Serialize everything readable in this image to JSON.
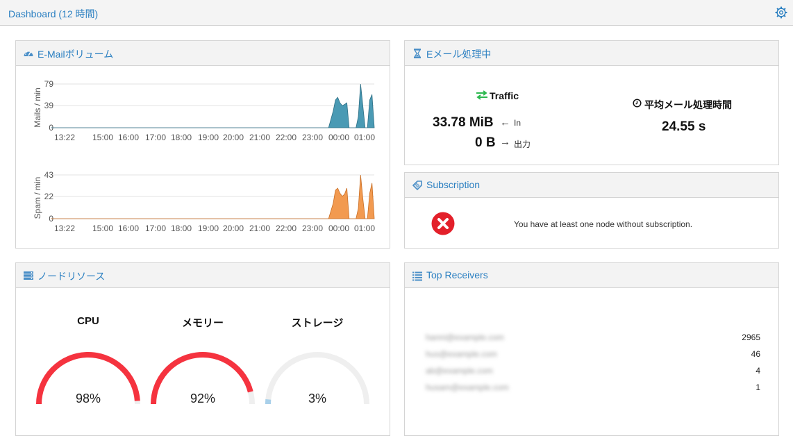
{
  "header": {
    "title": "Dashboard (12 時間)",
    "settings_icon": "gear-icon"
  },
  "volume_panel": {
    "title": "E-Mailボリューム",
    "icon": "dashboard-icon",
    "mail_chart": {
      "ylabel": "Mails / min",
      "yticks": [
        "79",
        "39",
        "0"
      ],
      "xticks": [
        "13:22",
        "15:00",
        "16:00",
        "17:00",
        "18:00",
        "19:00",
        "20:00",
        "21:00",
        "22:00",
        "23:00",
        "00:00",
        "01:00"
      ]
    },
    "spam_chart": {
      "ylabel": "Spam / min",
      "yticks": [
        "43",
        "22",
        "0"
      ],
      "xticks": [
        "13:22",
        "15:00",
        "16:00",
        "17:00",
        "18:00",
        "19:00",
        "20:00",
        "21:00",
        "22:00",
        "23:00",
        "00:00",
        "01:00"
      ]
    }
  },
  "chart_data": [
    {
      "type": "area",
      "title": "",
      "ylabel": "Mails / min",
      "ylim": [
        0,
        79
      ],
      "color": "#4a9ab4",
      "x": [
        "13:22",
        "23:10",
        "23:30",
        "23:40",
        "23:45",
        "23:50",
        "23:55",
        "00:00",
        "00:05",
        "00:10",
        "00:15",
        "00:20",
        "00:25",
        "00:30",
        "00:35",
        "00:40",
        "00:45",
        "00:50",
        "00:55",
        "01:00",
        "01:05",
        "01:10"
      ],
      "values": [
        0,
        0,
        0,
        30,
        50,
        55,
        45,
        40,
        42,
        45,
        0,
        0,
        0,
        0,
        20,
        79,
        40,
        0,
        0,
        50,
        60,
        0
      ]
    },
    {
      "type": "area",
      "title": "",
      "ylabel": "Spam / min",
      "ylim": [
        0,
        43
      ],
      "color": "#f29a50",
      "x": [
        "13:22",
        "23:10",
        "23:30",
        "23:40",
        "23:45",
        "23:50",
        "23:55",
        "00:00",
        "00:05",
        "00:10",
        "00:15",
        "00:20",
        "00:25",
        "00:30",
        "00:35",
        "00:40",
        "00:45",
        "00:50",
        "00:55",
        "01:00",
        "01:05",
        "01:10"
      ],
      "values": [
        0,
        0,
        0,
        15,
        28,
        30,
        25,
        22,
        24,
        30,
        0,
        0,
        0,
        0,
        10,
        43,
        20,
        0,
        0,
        25,
        35,
        0
      ]
    }
  ],
  "processing_panel": {
    "title": "Eメール処理中",
    "icon": "hourglass-icon",
    "traffic_label": "Traffic",
    "traffic_icon": "transfer-arrows-icon",
    "in_value": "33.78 MiB",
    "in_label": "In",
    "out_value": "0 B",
    "out_label": "出力",
    "avg_label": "平均メール処理時間",
    "avg_icon": "clock-icon",
    "avg_value": "24.55 s"
  },
  "subscription_panel": {
    "title": "Subscription",
    "icon": "tag-icon",
    "message": "You have at least one node without subscription.",
    "status_icon": "error-x-icon",
    "status_color": "#e3202a"
  },
  "resources_panel": {
    "title": "ノードリソース",
    "icon": "server-icon",
    "gauges": [
      {
        "label": "CPU",
        "value": "98%",
        "fraction": 0.98,
        "color": "#f5333f"
      },
      {
        "label": "メモリー",
        "value": "92%",
        "fraction": 0.92,
        "color": "#f5333f"
      },
      {
        "label": "ストレージ",
        "value": "3%",
        "fraction": 0.03,
        "color": "#a9d0ea"
      }
    ]
  },
  "receivers_panel": {
    "title": "Top Receivers",
    "icon": "list-icon",
    "rows": [
      {
        "email": "hanni@example.com",
        "count": "2965"
      },
      {
        "email": "hus@example.com",
        "count": "46"
      },
      {
        "email": "ab@example.com",
        "count": "4"
      },
      {
        "email": "husam@example.com",
        "count": "1"
      }
    ]
  }
}
